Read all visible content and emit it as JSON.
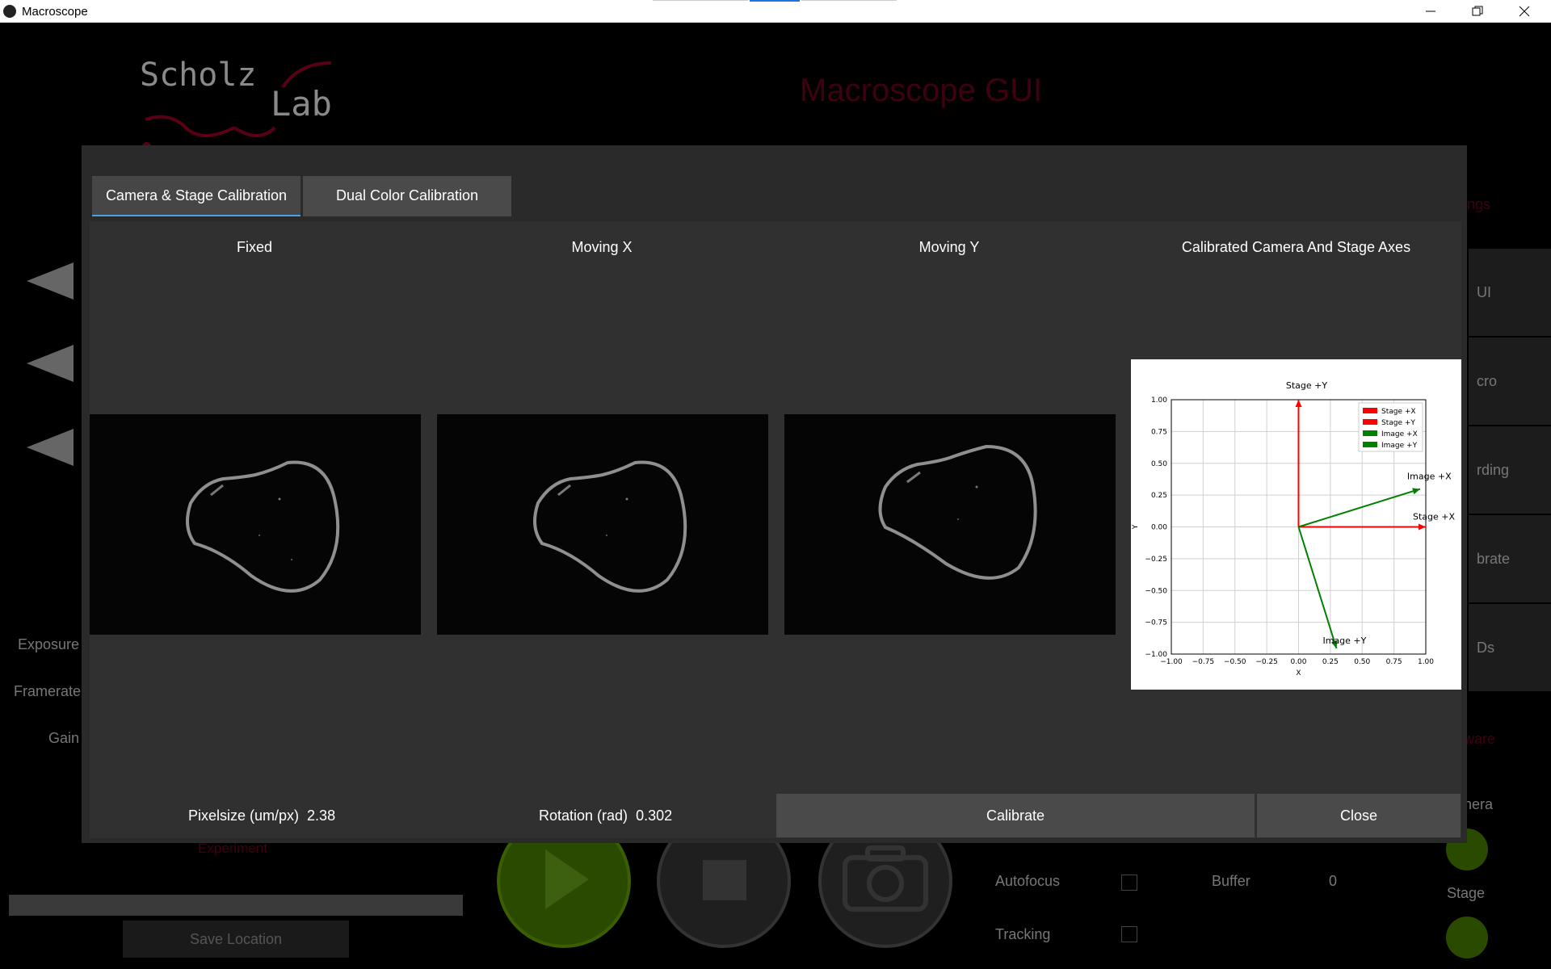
{
  "window": {
    "title": "Macroscope",
    "controls": [
      "minimize",
      "restore",
      "close"
    ]
  },
  "background": {
    "logo_line1": "Scholz",
    "logo_line2": "Lab",
    "app_title": "Macroscope GUI",
    "left_labels": [
      "Exposure",
      "Framerate",
      "Gain"
    ],
    "experiment_label": "Experiment",
    "save_location": "Save Location",
    "right_tabs": [
      "UI",
      "cro",
      "rding",
      "brate",
      "Ds"
    ],
    "right_red_top": "ings",
    "right_red_bottom": "ware",
    "camera_label": "nera",
    "stage_label": "Stage",
    "autofocus": "Autofocus",
    "tracking": "Tracking",
    "buffer": "Buffer",
    "buffer_value": "0"
  },
  "dialog": {
    "tabs": [
      {
        "label": "Camera & Stage Calibration",
        "active": true
      },
      {
        "label": "Dual Color Calibration",
        "active": false
      }
    ],
    "columns": [
      "Fixed",
      "Moving X",
      "Moving Y",
      "Calibrated Camera And Stage Axes"
    ],
    "pixelsize_label": "Pixelsize (um/px)",
    "pixelsize_value": "2.38",
    "rotation_label": "Rotation (rad)",
    "rotation_value": "0.302",
    "calibrate_button": "Calibrate",
    "close_button": "Close"
  },
  "chart_data": {
    "type": "line",
    "title": "",
    "xlabel": "X",
    "ylabel": "Y",
    "xlim": [
      -1.0,
      1.0
    ],
    "ylim": [
      -1.0,
      1.0
    ],
    "xticks": [
      "−1.00",
      "−0.75",
      "−0.50",
      "−0.25",
      "0.00",
      "0.25",
      "0.50",
      "0.75",
      "1.00"
    ],
    "yticks": [
      "1.00",
      "0.75",
      "0.50",
      "0.25",
      "0.00",
      "−0.25",
      "−0.50",
      "−0.75",
      "−1.00"
    ],
    "grid": true,
    "legend_position": "top-right",
    "series": [
      {
        "name": "Stage +X",
        "color": "#ff0000",
        "x": [
          0,
          1.0
        ],
        "y": [
          0,
          0
        ],
        "label": "Stage +X"
      },
      {
        "name": "Stage +Y",
        "color": "#ff0000",
        "x": [
          0,
          0
        ],
        "y": [
          0,
          1.0
        ],
        "label": "Stage +Y"
      },
      {
        "name": "Image +X",
        "color": "#008000",
        "x": [
          0,
          0.955
        ],
        "y": [
          0,
          0.298
        ],
        "label": "Image +X"
      },
      {
        "name": "Image +Y",
        "color": "#008000",
        "x": [
          0,
          0.298
        ],
        "y": [
          0,
          -0.955
        ],
        "label": "Image +Y"
      }
    ]
  }
}
